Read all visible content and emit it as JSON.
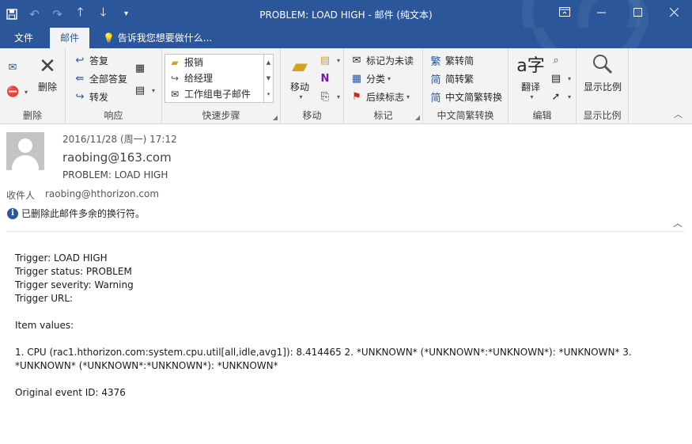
{
  "window": {
    "title": "PROBLEM: LOAD HIGH  -  邮件 (纯文本)"
  },
  "qat": {
    "save_icon": "save-icon",
    "undo_icon": "undo-icon",
    "redo_icon": "redo-icon",
    "up_icon": "up-arrow-icon",
    "down_icon": "down-arrow-icon",
    "customize_icon": "customize-icon"
  },
  "tabs": [
    {
      "label": "文件"
    },
    {
      "label": "邮件"
    }
  ],
  "tell_me": "告诉我您想要做什么...",
  "ribbon": {
    "groups": {
      "delete": "删除",
      "respond": "响应",
      "quick_steps": "快速步骤",
      "move": "移动",
      "tags": "标记",
      "chinese_conv": "中文简繁转换",
      "editing": "编辑",
      "zoom": "显示比例"
    },
    "delete_button": "删除",
    "reply": "答复",
    "reply_all": "全部答复",
    "forward": "转发",
    "quick_steps": [
      "报销",
      "给经理",
      "工作组电子邮件"
    ],
    "move_button": "移动",
    "mark_unread": "标记为未读",
    "categorize": "分类",
    "follow_up": "后续标志",
    "to_traditional": "繁转简",
    "to_simplified": "简转繁",
    "conversion": "中文简繁转换",
    "translate": "翻译",
    "zoom_button": "显示比例"
  },
  "message": {
    "date": "2016/11/28 (周一) 17:12",
    "sender": "raobing@163.com",
    "subject": "PROBLEM: LOAD HIGH",
    "to_label": "收件人",
    "to_value": "raobing@hthorizon.com",
    "info": "已删除此邮件多余的换行符。"
  },
  "body": {
    "trigger": "Trigger: LOAD HIGH",
    "status": "Trigger status: PROBLEM",
    "severity": "Trigger severity: Warning",
    "url": "Trigger URL:",
    "item_values": "Item values:",
    "values_text": "1. CPU (rac1.hthorizon.com:system.cpu.util[all,idle,avg1]): 8.414465 2. *UNKNOWN* (*UNKNOWN*:*UNKNOWN*): *UNKNOWN* 3. *UNKNOWN* (*UNKNOWN*:*UNKNOWN*): *UNKNOWN*",
    "event_id": "Original event ID: 4376"
  },
  "colors": {
    "accent": "#2b579a",
    "ribbon_bg": "#f3f3f3"
  }
}
